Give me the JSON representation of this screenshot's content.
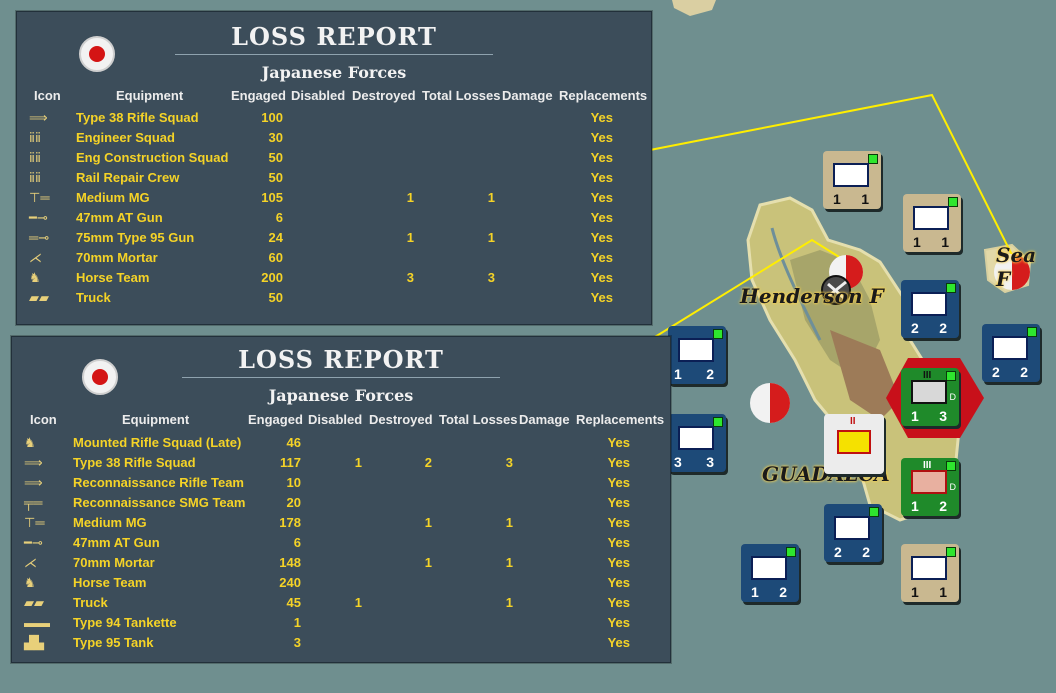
{
  "map": {
    "labels": {
      "henderson": "Henderson F",
      "guadalcanal": "GUADALCA",
      "sea": "Sea F"
    }
  },
  "report1": {
    "title": "LOSS REPORT",
    "subtitle": "Japanese Forces",
    "headers": [
      "Icon",
      "Equipment",
      "Engaged",
      "Disabled",
      "Destroyed",
      "Total Losses",
      "Damage",
      "Replacements"
    ],
    "rows": [
      {
        "icon": "rifle-icon",
        "equipment": "Type 38 Rifle Squad",
        "engaged": "100",
        "disabled": "",
        "destroyed": "",
        "total": "",
        "damage": "",
        "replacements": "Yes"
      },
      {
        "icon": "infantry-icon",
        "equipment": "Engineer Squad",
        "engaged": "30",
        "disabled": "",
        "destroyed": "",
        "total": "",
        "damage": "",
        "replacements": "Yes"
      },
      {
        "icon": "infantry-icon",
        "equipment": "Eng Construction Squad",
        "engaged": "50",
        "disabled": "",
        "destroyed": "",
        "total": "",
        "damage": "",
        "replacements": "Yes"
      },
      {
        "icon": "infantry-icon",
        "equipment": "Rail Repair Crew",
        "engaged": "50",
        "disabled": "",
        "destroyed": "",
        "total": "",
        "damage": "",
        "replacements": "Yes"
      },
      {
        "icon": "machine-gun-icon",
        "equipment": "Medium MG",
        "engaged": "105",
        "disabled": "",
        "destroyed": "1",
        "total": "1",
        "damage": "",
        "replacements": "Yes"
      },
      {
        "icon": "at-gun-icon",
        "equipment": "47mm AT Gun",
        "engaged": "6",
        "disabled": "",
        "destroyed": "",
        "total": "",
        "damage": "",
        "replacements": "Yes"
      },
      {
        "icon": "field-gun-icon",
        "equipment": "75mm Type 95 Gun",
        "engaged": "24",
        "disabled": "",
        "destroyed": "1",
        "total": "1",
        "damage": "",
        "replacements": "Yes"
      },
      {
        "icon": "mortar-icon",
        "equipment": "70mm Mortar",
        "engaged": "60",
        "disabled": "",
        "destroyed": "",
        "total": "",
        "damage": "",
        "replacements": "Yes"
      },
      {
        "icon": "horse-icon",
        "equipment": "Horse Team",
        "engaged": "200",
        "disabled": "",
        "destroyed": "3",
        "total": "3",
        "damage": "",
        "replacements": "Yes"
      },
      {
        "icon": "truck-icon",
        "equipment": "Truck",
        "engaged": "50",
        "disabled": "",
        "destroyed": "",
        "total": "",
        "damage": "",
        "replacements": "Yes"
      }
    ]
  },
  "report2": {
    "title": "LOSS REPORT",
    "subtitle": "Japanese Forces",
    "headers": [
      "Icon",
      "Equipment",
      "Engaged",
      "Disabled",
      "Destroyed",
      "Total Losses",
      "Damage",
      "Replacements"
    ],
    "rows": [
      {
        "icon": "horse-icon",
        "equipment": "Mounted Rifle Squad (Late)",
        "engaged": "46",
        "disabled": "",
        "destroyed": "",
        "total": "",
        "damage": "",
        "replacements": "Yes"
      },
      {
        "icon": "rifle-icon",
        "equipment": "Type 38 Rifle Squad",
        "engaged": "117",
        "disabled": "1",
        "destroyed": "2",
        "total": "3",
        "damage": "",
        "replacements": "Yes"
      },
      {
        "icon": "rifle-icon",
        "equipment": "Reconnaissance Rifle Team",
        "engaged": "10",
        "disabled": "",
        "destroyed": "",
        "total": "",
        "damage": "",
        "replacements": "Yes"
      },
      {
        "icon": "smg-icon",
        "equipment": "Reconnaissance SMG Team",
        "engaged": "20",
        "disabled": "",
        "destroyed": "",
        "total": "",
        "damage": "",
        "replacements": "Yes"
      },
      {
        "icon": "machine-gun-icon",
        "equipment": "Medium MG",
        "engaged": "178",
        "disabled": "",
        "destroyed": "1",
        "total": "1",
        "damage": "",
        "replacements": "Yes"
      },
      {
        "icon": "at-gun-icon",
        "equipment": "47mm AT Gun",
        "engaged": "6",
        "disabled": "",
        "destroyed": "",
        "total": "",
        "damage": "",
        "replacements": "Yes"
      },
      {
        "icon": "mortar-icon",
        "equipment": "70mm Mortar",
        "engaged": "148",
        "disabled": "",
        "destroyed": "1",
        "total": "1",
        "damage": "",
        "replacements": "Yes"
      },
      {
        "icon": "horse-icon",
        "equipment": "Horse Team",
        "engaged": "240",
        "disabled": "",
        "destroyed": "",
        "total": "",
        "damage": "",
        "replacements": "Yes"
      },
      {
        "icon": "truck-icon",
        "equipment": "Truck",
        "engaged": "45",
        "disabled": "1",
        "destroyed": "",
        "total": "1",
        "damage": "",
        "replacements": "Yes"
      },
      {
        "icon": "tankette-icon",
        "equipment": "Type 94 Tankette",
        "engaged": "1",
        "disabled": "",
        "destroyed": "",
        "total": "",
        "damage": "",
        "replacements": "Yes"
      },
      {
        "icon": "tank-icon",
        "equipment": "Type 95 Tank",
        "engaged": "3",
        "disabled": "",
        "destroyed": "",
        "total": "",
        "damage": "",
        "replacements": "Yes"
      }
    ]
  },
  "counters": [
    {
      "name": "naval-counter",
      "color": "#c9b890",
      "left": "1",
      "right": "1"
    },
    {
      "name": "naval-counter",
      "color": "#c9b890",
      "left": "1",
      "right": "1"
    },
    {
      "name": "naval-counter",
      "color": "#1d4a78",
      "left": "2",
      "right": "2"
    },
    {
      "name": "naval-counter",
      "color": "#1d4a78",
      "left": "2",
      "right": "2"
    },
    {
      "name": "naval-counter",
      "color": "#1d4a78",
      "left": "1",
      "right": "2"
    },
    {
      "name": "naval-counter",
      "color": "#1d4a78",
      "left": "3",
      "right": "3"
    },
    {
      "name": "naval-counter",
      "color": "#1d4a78",
      "left": "2",
      "right": "2"
    },
    {
      "name": "naval-counter",
      "color": "#1d4a78",
      "left": "1",
      "right": "2"
    },
    {
      "name": "naval-counter",
      "color": "#c9b890",
      "left": "1",
      "right": "1"
    },
    {
      "name": "land-counter",
      "color": "#1f8a2a",
      "left": "1",
      "right": "3"
    },
    {
      "name": "land-counter",
      "color": "#1f8a2a",
      "left": "1",
      "right": "2"
    }
  ],
  "unit_size_marks": {
    "regiment": "III",
    "battalion": "II",
    "land_type": "D"
  },
  "icons": {
    "rifle-icon": "⟹",
    "infantry-icon": "ⅱⅱ",
    "machine-gun-icon": "⊤═",
    "at-gun-icon": "━⊸",
    "field-gun-icon": "═⊸",
    "mortar-icon": "⋌",
    "horse-icon": "♞",
    "truck-icon": "▰▰",
    "smg-icon": "╤═",
    "tankette-icon": "▬▬",
    "tank-icon": "▟▙"
  }
}
